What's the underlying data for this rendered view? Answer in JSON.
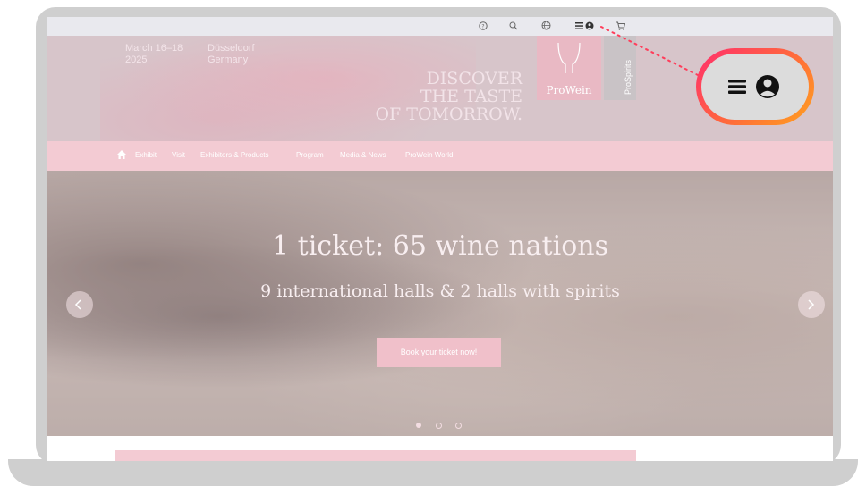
{
  "header": {
    "event_date": "March 16–18 2025",
    "event_location": "Düsseldorf Germany",
    "tagline": [
      "DISCOVER",
      "THE TASTE",
      "OF TOMORROW."
    ],
    "logo_primary": "ProWein",
    "logo_secondary": "ProSpirits"
  },
  "utility_icons": [
    "help-icon",
    "search-icon",
    "globe-icon",
    "menu-account-icon",
    "cart-icon"
  ],
  "nav": {
    "items": [
      "Exhibit",
      "Visit",
      "Exhibitors & Products",
      "Program",
      "Media & News",
      "ProWein World"
    ]
  },
  "hero": {
    "title": "1 ticket: 65 wine nations",
    "subtitle": "9 international halls & 2 halls with spirits",
    "cta": "Book your ticket now!",
    "slides": 3,
    "active_slide": 1
  },
  "colors": {
    "accent_pink": "#f3cbd3",
    "header_bg": "#d7c5ca",
    "callout_gradient": [
      "#ff2d6f",
      "#ffa21f"
    ]
  }
}
